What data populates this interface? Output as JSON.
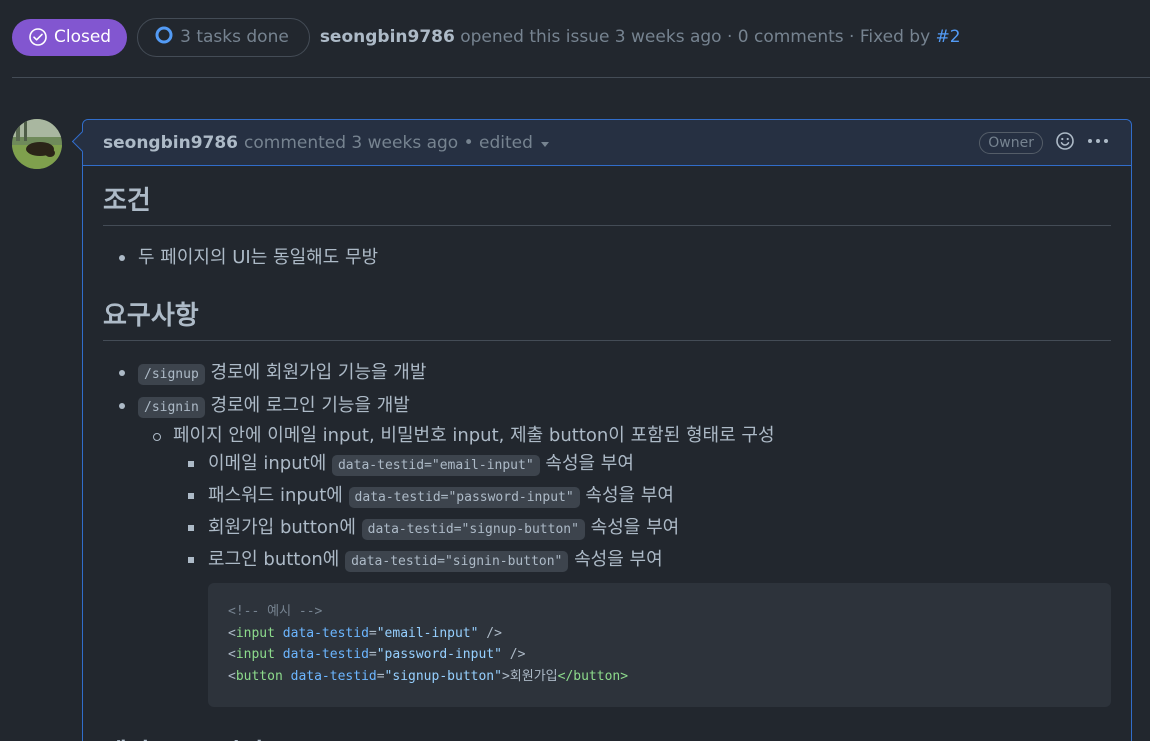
{
  "issue": {
    "title": "",
    "state": "Closed",
    "tasks": "3 tasks done",
    "author": "seongbin9786",
    "opened_text": "opened this issue 3 weeks ago · 0 comments · Fixed by",
    "fixed_by": "#2"
  },
  "comment": {
    "author": "seongbin9786",
    "meta": "commented 3 weeks ago • edited",
    "owner_badge": "Owner",
    "sections": {
      "s1_title": "조건",
      "s1_items": [
        "두 페이지의 UI는 동일해도 무방"
      ],
      "s2_title": "요구사항",
      "s2_item1_code": "/signup",
      "s2_item1_text": " 경로에 회원가입 기능을 개발",
      "s2_item2_code": "/signin",
      "s2_item2_text": " 경로에 로그인 기능을 개발",
      "s2_sub_text": "페이지 안에 이메일 input, 비밀번호 input, 제출 button이 포함된 형태로 구성",
      "s2_sub_items": [
        {
          "pre": "이메일 input에 ",
          "code": "data-testid=\"email-input\"",
          "post": " 속성을 부여"
        },
        {
          "pre": "패스워드 input에 ",
          "code": "data-testid=\"password-input\"",
          "post": " 속성을 부여"
        },
        {
          "pre": "회원가입 button에 ",
          "code": "data-testid=\"signup-button\"",
          "post": " 속성을 부여"
        },
        {
          "pre": "로그인 button에 ",
          "code": "data-testid=\"signin-button\"",
          "post": " 속성을 부여"
        }
      ],
      "code_block": {
        "comment": "<!-- 예시 -->",
        "lines": [
          {
            "open": "<",
            "tag": "input",
            "attr": "data-testid",
            "eq": "=",
            "val": "\"email-input\"",
            "close": " />",
            "text": "",
            "end_tag": ""
          },
          {
            "open": "<",
            "tag": "input",
            "attr": "data-testid",
            "eq": "=",
            "val": "\"password-input\"",
            "close": " />",
            "text": "",
            "end_tag": ""
          },
          {
            "open": "<",
            "tag": "button",
            "attr": "data-testid",
            "eq": "=",
            "val": "\"signup-button\"",
            "close": ">",
            "text": "회원가입",
            "end_tag": "</button>"
          }
        ]
      },
      "s3_title": "예상 소요 시간"
    }
  },
  "colors": {
    "background": "#22272e",
    "closed_badge": "#8256d0",
    "link": "#539bf5",
    "comment_border": "#316dca"
  }
}
